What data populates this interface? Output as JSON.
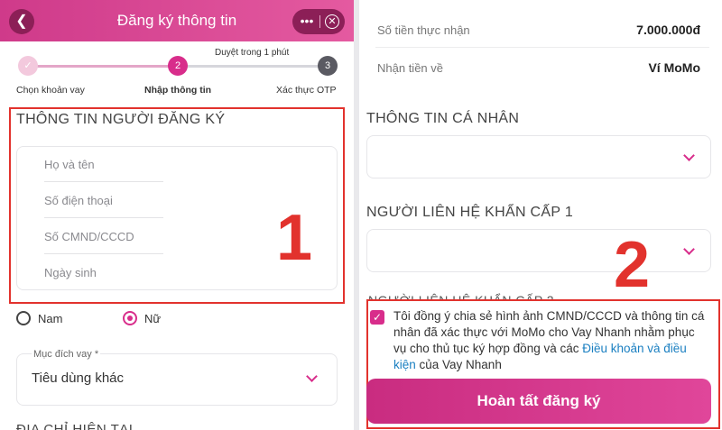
{
  "left": {
    "header": {
      "title": "Đăng ký thông tin",
      "back_icon": "chevron-left-icon",
      "more_icon": "more-icon",
      "close_icon": "close-icon"
    },
    "stepper": {
      "time_note": "Duyệt trong 1 phút",
      "steps": [
        {
          "number": "",
          "label": "Chọn khoản vay",
          "state": "done"
        },
        {
          "number": "2",
          "label": "Nhập thông tin",
          "state": "active"
        },
        {
          "number": "3",
          "label": "Xác thực OTP",
          "state": "pending"
        }
      ]
    },
    "registrant": {
      "title": "THÔNG TIN NGƯỜI ĐĂNG KÝ",
      "fields": [
        {
          "placeholder": "Họ và tên"
        },
        {
          "placeholder": "Số điện thoại"
        },
        {
          "placeholder": "Số CMND/CCCD"
        },
        {
          "placeholder": "Ngày sinh"
        }
      ],
      "annotation": "1"
    },
    "gender": {
      "options": [
        "Nam",
        "Nữ"
      ],
      "selected": "Nữ"
    },
    "purpose": {
      "label": "Mục đích vay *",
      "value": "Tiêu dùng khác"
    },
    "next_section_cutoff": "ĐỊA CHỈ HIỆN TẠI"
  },
  "right": {
    "summary": [
      {
        "label": "Số tiền thực nhận",
        "value": "7.000.000đ"
      },
      {
        "label": "Nhận tiền về",
        "value": "Ví MoMo"
      }
    ],
    "personal_info_title": "THÔNG TIN CÁ NHÂN",
    "emergency_contact_title": "NGƯỜI LIÊN HỆ KHẨN CẤP 1",
    "next_section_cutoff": "NGƯỜI LIÊN HỆ KHẨN CẤP 2",
    "annotation": "2",
    "consent": {
      "text": "Tôi đồng ý chia sẻ hình ảnh CMND/CCCD và thông tin cá nhân đã xác thực với MoMo cho Vay Nhanh nhằm phục vụ cho thủ tục ký hợp đồng và các ",
      "link": "Điều khoản và điều kiện",
      "suffix": " của Vay Nhanh",
      "checked": true
    },
    "submit_label": "Hoàn tất đăng ký"
  },
  "colors": {
    "brand_pink": "#d82d8b",
    "annotation_red": "#e2322d",
    "link_blue": "#1a7fc1"
  }
}
